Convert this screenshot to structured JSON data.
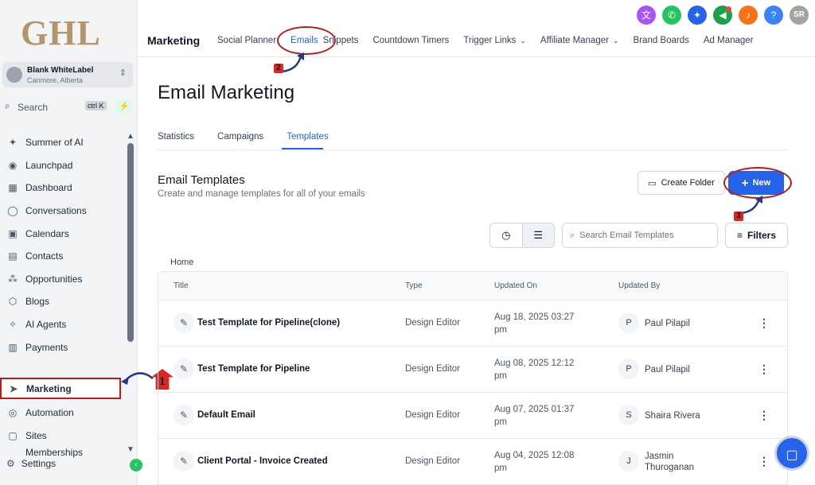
{
  "brand": {
    "logo_text": "GHL"
  },
  "account": {
    "name": "Blank WhiteLabel",
    "location": "Canmore, Alberta"
  },
  "sidebar_search": {
    "label": "Search",
    "shortcut": "ctrl K"
  },
  "sidebar": {
    "items": [
      {
        "label": "Summer of AI",
        "icon": "sparkle-icon"
      },
      {
        "label": "Launchpad",
        "icon": "rocket-icon"
      },
      {
        "label": "Dashboard",
        "icon": "grid-icon"
      },
      {
        "label": "Conversations",
        "icon": "chat-icon"
      },
      {
        "label": "Calendars",
        "icon": "calendar-icon"
      },
      {
        "label": "Contacts",
        "icon": "contacts-icon"
      },
      {
        "label": "Opportunities",
        "icon": "opportunities-icon"
      },
      {
        "label": "Blogs",
        "icon": "blog-icon"
      },
      {
        "label": "AI Agents",
        "icon": "ai-agent-icon"
      },
      {
        "label": "Payments",
        "icon": "payments-icon"
      }
    ],
    "active": {
      "label": "Marketing",
      "icon": "send-icon"
    },
    "bottom_items": [
      {
        "label": "Automation",
        "icon": "automation-icon"
      },
      {
        "label": "Sites",
        "icon": "sites-icon"
      },
      {
        "label": "Memberships",
        "icon": "membership-icon"
      }
    ],
    "settings": "Settings"
  },
  "topbar": {
    "module_title": "Marketing",
    "tabs": [
      {
        "label": "Social Planner"
      },
      {
        "label": "Emails",
        "active": true
      },
      {
        "label": "Snippets"
      },
      {
        "label": "Countdown Timers"
      },
      {
        "label": "Trigger Links",
        "dropdown": true
      },
      {
        "label": "Affiliate Manager",
        "dropdown": true
      },
      {
        "label": "Brand Boards"
      },
      {
        "label": "Ad Manager"
      }
    ],
    "user_initials": "SR",
    "icons": [
      {
        "name": "translate-icon",
        "color": "#a855f7"
      },
      {
        "name": "phone-icon",
        "color": "#22c55e"
      },
      {
        "name": "magic-icon",
        "color": "#2563eb"
      },
      {
        "name": "megaphone-icon",
        "color": "#16a34a"
      },
      {
        "name": "bell-icon",
        "color": "#f97316"
      },
      {
        "name": "help-icon",
        "color": "#3b82f6"
      }
    ]
  },
  "page": {
    "title": "Email Marketing",
    "subtabs": [
      "Statistics",
      "Campaigns",
      "Templates"
    ],
    "active_subtab": "Templates",
    "section_title": "Email Templates",
    "section_subtitle": "Create and manage templates for all of your emails",
    "create_folder": "Create Folder",
    "new_button": "New",
    "search_placeholder": "Search Email Templates",
    "filters": "Filters",
    "breadcrumb": "Home"
  },
  "table": {
    "columns": [
      "Title",
      "Type",
      "Updated On",
      "Updated By"
    ],
    "rows": [
      {
        "title": "Test Template for Pipeline(clone)",
        "type": "Design Editor",
        "updated_on_1": "Aug 18, 2025 03:27",
        "updated_on_2": "pm",
        "initial": "P",
        "by_1": "Paul Pilapil",
        "by_2": ""
      },
      {
        "title": "Test Template for Pipeline",
        "type": "Design Editor",
        "updated_on_1": "Aug 08, 2025 12:12",
        "updated_on_2": "pm",
        "initial": "P",
        "by_1": "Paul Pilapil",
        "by_2": ""
      },
      {
        "title": "Default Email",
        "type": "Design Editor",
        "updated_on_1": "Aug 07, 2025 01:37",
        "updated_on_2": "pm",
        "initial": "S",
        "by_1": "Shaira Rivera",
        "by_2": ""
      },
      {
        "title": "Client Portal - Invoice Created",
        "type": "Design Editor",
        "updated_on_1": "Aug 04, 2025 12:08",
        "updated_on_2": "pm",
        "initial": "J",
        "by_1": "Jasmin",
        "by_2": "Thuroganan"
      }
    ]
  },
  "annotations": {
    "step1": "1",
    "step2": "2",
    "step3": "3"
  }
}
